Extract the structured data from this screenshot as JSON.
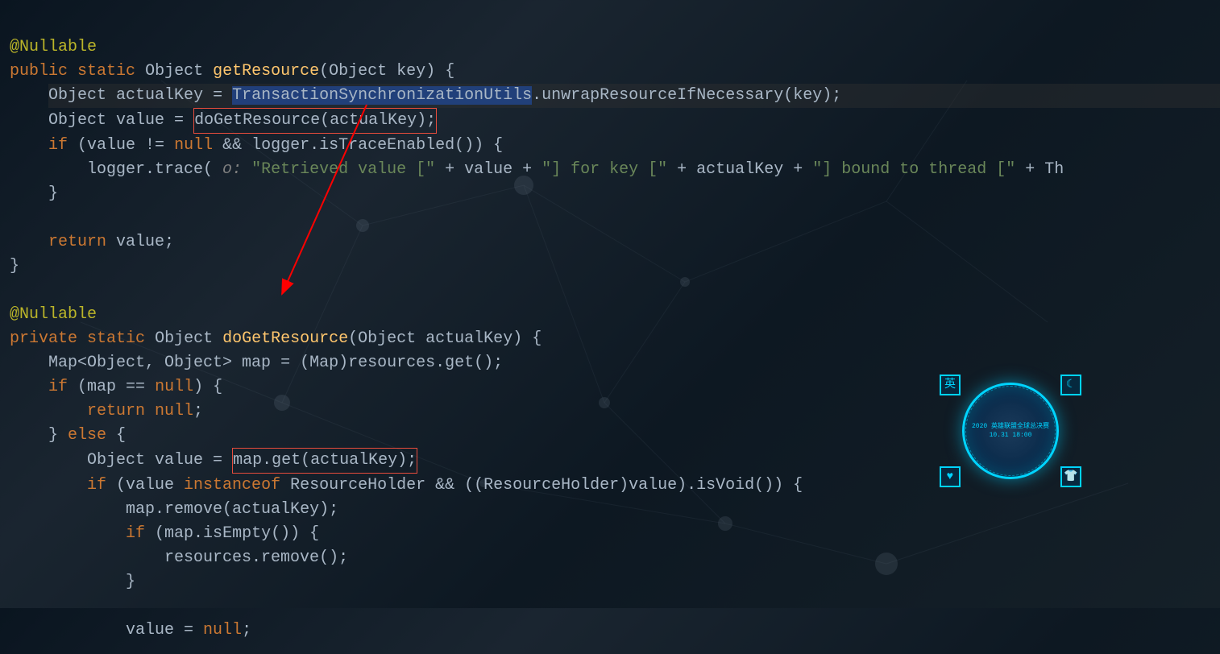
{
  "code": {
    "line1_annotation": "@Nullable",
    "line2_public": "public",
    "line2_static": "static",
    "line2_type": "Object",
    "line2_method": "getResource",
    "line2_paramtype": "Object",
    "line2_paramname": "key",
    "line3_type": "Object",
    "line3_var": "actualKey",
    "line3_class": "TransactionSynchronizationUtils",
    "line3_method": ".unwrapResourceIfNecessary(key);",
    "line4_type": "Object",
    "line4_var": "value = ",
    "line4_call": "doGetResource(actualKey);",
    "line5_if": "if",
    "line5_cond": " (value != ",
    "line5_null": "null",
    "line5_and": " && logger.isTraceEnabled()) {",
    "line6_logger": "logger.trace( ",
    "line6_o": "o: ",
    "line6_str1": "\"Retrieved value [\"",
    "line6_plus1": " + value + ",
    "line6_str2": "\"] for key [\"",
    "line6_plus2": " + actualKey + ",
    "line6_str3": "\"] bound to thread [\"",
    "line6_plus3": " + Th",
    "line7_brace": "}",
    "line9_return": "return",
    "line9_val": " value;",
    "line10_brace": "}",
    "line12_annotation": "@Nullable",
    "line13_private": "private",
    "line13_static": "static",
    "line13_type": "Object",
    "line13_method": "doGetResource",
    "line13_paramtype": "Object",
    "line13_paramname": "actualKey",
    "line14_map": "Map<Object, Object> map = (Map)resources.get();",
    "line15_if": "if",
    "line15_cond": " (map == ",
    "line15_null": "null",
    "line15_brace": ") {",
    "line16_return": "return null",
    "line16_semi": ";",
    "line17_brace": "} ",
    "line17_else": "else",
    "line17_brace2": " {",
    "line18_type": "Object",
    "line18_var": " value = ",
    "line18_call": "map.get(actualKey);",
    "line19_if": "if",
    "line19_cond": " (value ",
    "line19_instanceof": "instanceof",
    "line19_rest": " ResourceHolder && ((ResourceHolder)value).isVoid()) {",
    "line20": "map.remove(actualKey);",
    "line21_if": "if",
    "line21_cond": " (map.isEmpty()) {",
    "line22": "resources.remove();",
    "line23_brace": "}",
    "line25_var": "value = ",
    "line25_null": "null",
    "line25_semi": ";"
  },
  "widget": {
    "text1": "2020 英雄联盟全球总决赛",
    "text2": "10.31 18:00",
    "corner_tl": "英",
    "corner_tr": "☾",
    "corner_bl": "♥",
    "corner_br": "👕"
  }
}
